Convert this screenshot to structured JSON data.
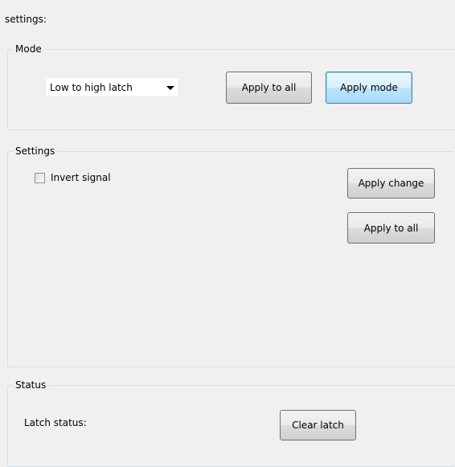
{
  "panel": {
    "title": "settings:"
  },
  "mode_group": {
    "title": "Mode",
    "mode_select": {
      "value": "Low to high latch"
    },
    "apply_to_all_label": "Apply to all",
    "apply_mode_label": "Apply mode"
  },
  "settings_group": {
    "title": "Settings",
    "invert_signal": {
      "label": "Invert signal",
      "checked": false
    },
    "apply_change_label": "Apply change",
    "apply_to_all_label": "Apply to all"
  },
  "status_group": {
    "title": "Status",
    "latch_status_label": "Latch status:",
    "clear_latch_label": "Clear latch"
  },
  "colors": {
    "window_bg": "#f0f0f0",
    "group_border": "#d5dfe5",
    "focused_button_border": "#3c7fb1",
    "button_border": "#707070"
  },
  "icons": {
    "combo_arrow": "chevron-down-icon"
  }
}
